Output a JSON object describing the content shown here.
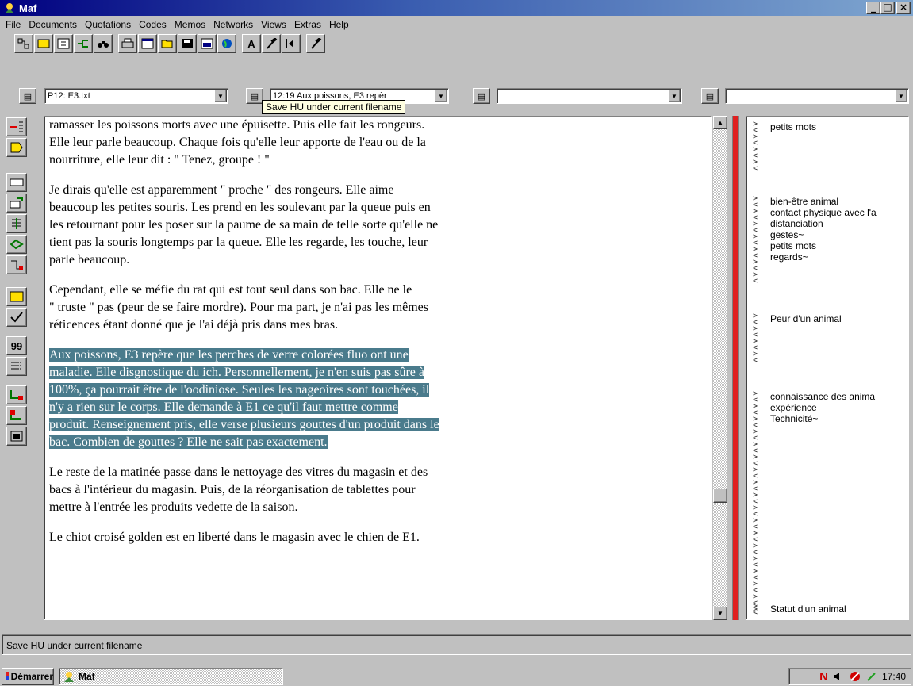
{
  "window": {
    "title": "Maf"
  },
  "menu": [
    "File",
    "Documents",
    "Quotations",
    "Codes",
    "Memos",
    "Networks",
    "Views",
    "Extras",
    "Help"
  ],
  "toolbar": {
    "buttons": [
      "code-tree-icon",
      "frame-icon",
      "split-icon",
      "hierarchy-icon",
      "binoculars-icon",
      "printer-icon",
      "window-icon",
      "open-folder-icon",
      "save-icon",
      "panel-icon",
      "globe-icon",
      "font-icon",
      "hammer-icon",
      "back-icon",
      "hammer-icon"
    ],
    "font_label": "A"
  },
  "selectors": {
    "document": "P12: E3.txt",
    "quotation": "12:19 Aux poissons, E3 repèr",
    "codes": "",
    "memos": ""
  },
  "tooltip": "Save HU under current filename",
  "lefttools": {
    "quote_label": "99"
  },
  "document": {
    "paragraphs": [
      {
        "text": "ramasser les poissons morts avec une épuisette. Puis elle fait les rongeurs.\nElle leur parle beaucoup. Chaque fois qu'elle leur apporte de l'eau ou de la\nnourriture, elle leur dit : \" Tenez, groupe ! \"",
        "highlight": false
      },
      {
        "text": "Je dirais qu'elle est apparemment \" proche \" des rongeurs. Elle aime\nbeaucoup les petites souris. Les prend en les soulevant par la queue puis en\nles retournant pour les poser sur la paume de sa main de telle sorte qu'elle ne\ntient pas la souris longtemps par la queue. Elle les regarde, les touche, leur\nparle beaucoup.",
        "highlight": false
      },
      {
        "text": "Cependant, elle se méfie du rat qui est tout seul dans son bac. Elle ne le\n\" truste \" pas (peur de se faire mordre). Pour ma part, je n'ai pas les mêmes\nréticences étant donné que je l'ai déjà pris dans mes bras.",
        "highlight": false
      },
      {
        "text": "Aux poissons, E3 repère que les perches de verre colorées fluo ont une\nmaladie. Elle disgnostique du ich. Personnellement, je n'en suis pas sûre à\n100%, ça pourrait être de l'oodiniose. Seules les nageoires sont touchées, il\nn'y a rien sur le corps. Elle demande à E1 ce qu'il faut mettre comme\nproduit. Renseignement pris, elle verse plusieurs gouttes d'un produit dans le\nbac. Combien de gouttes ? Elle ne sait pas exactement.",
        "highlight": true
      },
      {
        "text": "Le reste de la matinée passe dans le nettoyage des vitres du magasin et des\nbacs à l'intérieur du magasin. Puis, de la réorganisation de tablettes pour\nmettre à l'entrée les produits vedette de la saison.",
        "highlight": false
      },
      {
        "text": "Le chiot croisé golden est en liberté dans le magasin avec le chien de E1.",
        "highlight": false
      }
    ]
  },
  "margin": {
    "groups": [
      {
        "codes": [
          "petits mots"
        ]
      },
      {
        "codes": [
          "bien-être animal",
          "contact physique avec l'a",
          "distanciation",
          "gestes~",
          "petits mots",
          "regards~"
        ]
      },
      {
        "codes": [
          "Peur d'un animal"
        ]
      },
      {
        "codes": [
          "connaissance des anima",
          "expérience",
          "Technicité~"
        ]
      },
      {
        "codes": [
          "Statut d'un animal"
        ]
      }
    ]
  },
  "status": "Save HU under current filename",
  "taskbar": {
    "start": "Démarrer",
    "app": "Maf",
    "clock": "17:40",
    "tray_n": "N"
  },
  "colors": {
    "highlight": "#4a7b8c",
    "margin_bar": "#e02020",
    "titlebar": "#000080"
  }
}
